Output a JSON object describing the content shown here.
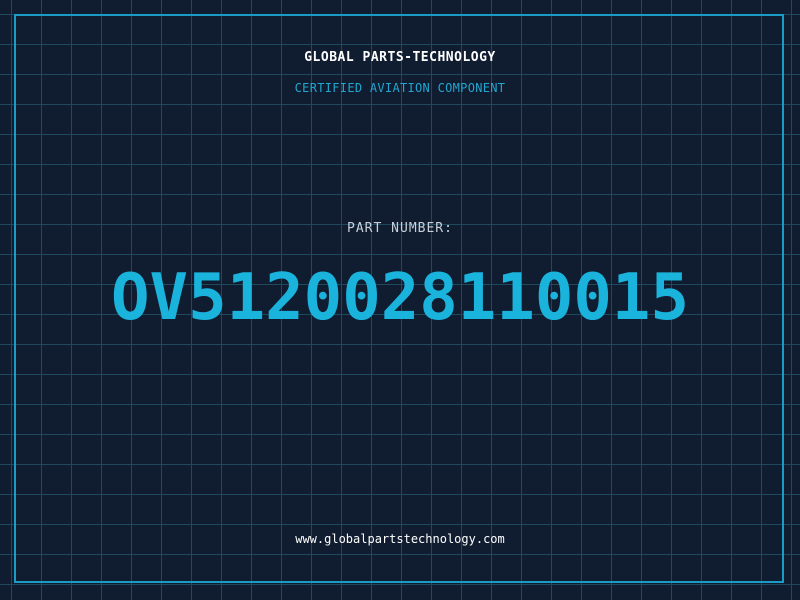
{
  "header": {
    "company": "GLOBAL PARTS-TECHNOLOGY",
    "subtitle": "CERTIFIED AVIATION COMPONENT"
  },
  "part": {
    "label": "PART NUMBER:",
    "number": "OV5120028110015"
  },
  "footer": {
    "website": "www.globalpartstechnology.com"
  },
  "colors": {
    "background": "#101c30",
    "grid": "#1f4a5e",
    "accent": "#19b3dc",
    "frame": "#1a9cc6"
  }
}
